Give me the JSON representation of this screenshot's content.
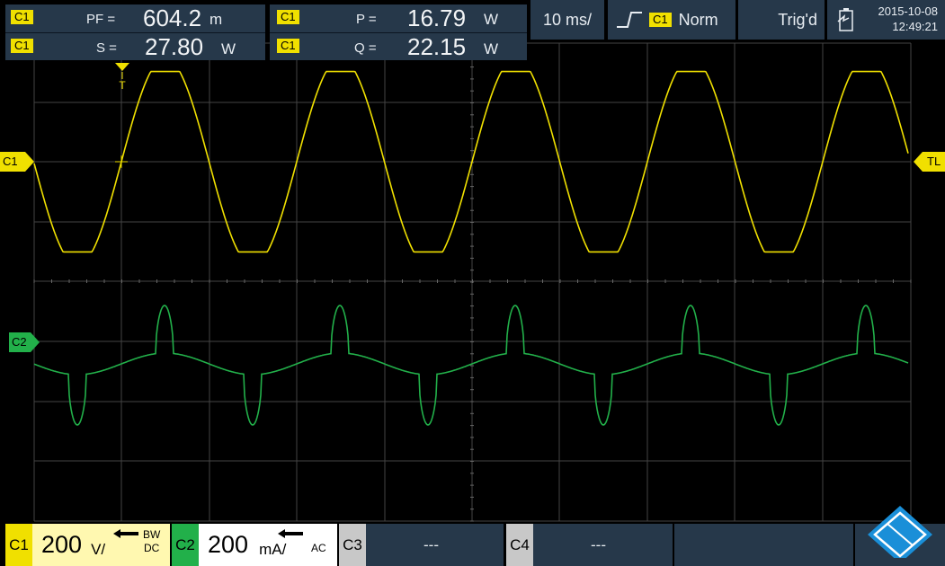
{
  "measurements": [
    {
      "channel": "C1",
      "label": "PF =",
      "value": "604.2",
      "unit": "m"
    },
    {
      "channel": "C1",
      "label": "S =",
      "value": "27.80",
      "unit": "W"
    },
    {
      "channel": "C1",
      "label": "P =",
      "value": "16.79",
      "unit": "W"
    },
    {
      "channel": "C1",
      "label": "Q =",
      "value": "22.15",
      "unit": "W"
    }
  ],
  "timebase": "10 ms/",
  "trigger": {
    "source": "C1",
    "mode": "Norm",
    "state": "Trig'd",
    "marker": "T",
    "level_marker": "TL"
  },
  "datetime": {
    "date": "2015-10-08",
    "time": "12:49:21"
  },
  "channel_markers": {
    "c1": "C1",
    "c2": "C2"
  },
  "bottom": {
    "c1": {
      "tag": "C1",
      "scale": "200",
      "unit": "V/",
      "bw": "BW",
      "coupling": "DC"
    },
    "c2": {
      "tag": "C2",
      "scale": "200",
      "unit": "mA/",
      "coupling": "AC"
    },
    "c3": {
      "tag": "C3",
      "value": "---"
    },
    "c4": {
      "tag": "C4",
      "value": "---"
    }
  },
  "colors": {
    "ch1": "#f0e000",
    "ch2": "#22b04a",
    "panel": "#26384a",
    "grid": "#4a4a4a",
    "logo": "#1a8fd8"
  }
}
